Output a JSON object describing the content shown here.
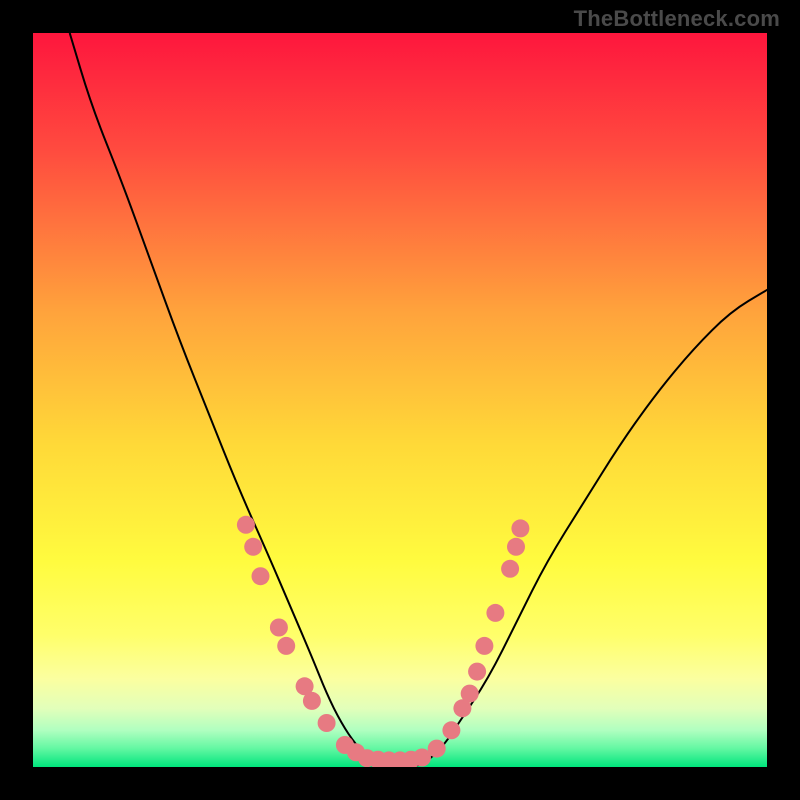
{
  "watermark": "TheBottleneck.com",
  "colors": {
    "gradient_top": "#fe163d",
    "gradient_mid1": "#ff7a3e",
    "gradient_mid2": "#ffe138",
    "gradient_bottom1": "#ffff66",
    "gradient_bottom2": "#f7ffb0",
    "gradient_bottom3": "#aaffb8",
    "gradient_end": "#00e57c",
    "dot": "#e77a82",
    "curve_stroke": "#000000"
  },
  "chart_data": {
    "type": "line",
    "title": "",
    "xlabel": "",
    "ylabel": "",
    "xlim": [
      0,
      100
    ],
    "ylim": [
      0,
      100
    ],
    "series": [
      {
        "name": "bottleneck-curve",
        "x": [
          5,
          8,
          12,
          16,
          20,
          24,
          28,
          32,
          35,
          38,
          40,
          42,
          44,
          46,
          48,
          50,
          52,
          54,
          56,
          58,
          62,
          66,
          70,
          75,
          80,
          85,
          90,
          95,
          100
        ],
        "y": [
          100,
          90,
          80,
          69,
          58,
          48,
          38,
          29,
          22,
          15,
          10,
          6,
          3,
          1,
          0,
          0,
          0,
          1,
          3,
          6,
          12,
          20,
          28,
          36,
          44,
          51,
          57,
          62,
          65
        ]
      }
    ],
    "dots": [
      {
        "x": 29,
        "y": 33
      },
      {
        "x": 30,
        "y": 30
      },
      {
        "x": 31,
        "y": 26
      },
      {
        "x": 33.5,
        "y": 19
      },
      {
        "x": 34.5,
        "y": 16.5
      },
      {
        "x": 37,
        "y": 11
      },
      {
        "x": 38,
        "y": 9
      },
      {
        "x": 40,
        "y": 6
      },
      {
        "x": 42.5,
        "y": 3
      },
      {
        "x": 44,
        "y": 2
      },
      {
        "x": 45.5,
        "y": 1.2
      },
      {
        "x": 47,
        "y": 1
      },
      {
        "x": 48.5,
        "y": 0.9
      },
      {
        "x": 50,
        "y": 0.9
      },
      {
        "x": 51.5,
        "y": 1
      },
      {
        "x": 53,
        "y": 1.3
      },
      {
        "x": 55,
        "y": 2.5
      },
      {
        "x": 57,
        "y": 5
      },
      {
        "x": 58.5,
        "y": 8
      },
      {
        "x": 59.5,
        "y": 10
      },
      {
        "x": 60.5,
        "y": 13
      },
      {
        "x": 61.5,
        "y": 16.5
      },
      {
        "x": 63,
        "y": 21
      },
      {
        "x": 65,
        "y": 27
      },
      {
        "x": 65.8,
        "y": 30
      },
      {
        "x": 66.4,
        "y": 32.5
      }
    ]
  }
}
